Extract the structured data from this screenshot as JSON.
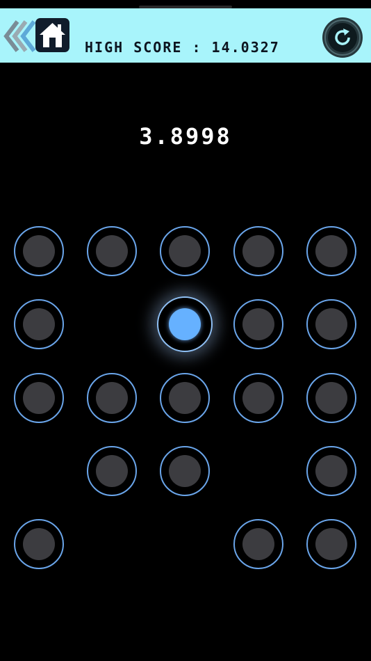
{
  "header": {
    "back_icon": "double-chevron-left-icon",
    "home_icon": "home-icon",
    "high_score_text": "HIGH SCORE : 14.0327",
    "restart_icon": "restart-icon"
  },
  "current_score": "3.8998",
  "colors": {
    "topbar": "#a8f4fb",
    "background": "#000000",
    "dot_ring": "#6aa5ea",
    "dot_core": "#3c3c40",
    "dot_active": "#66b1ff"
  },
  "grid": {
    "columns": 5,
    "rows": 5,
    "cells": [
      [
        1,
        1,
        1,
        1,
        1
      ],
      [
        1,
        0,
        2,
        1,
        1
      ],
      [
        1,
        1,
        1,
        1,
        1
      ],
      [
        0,
        1,
        1,
        0,
        1
      ],
      [
        1,
        0,
        0,
        1,
        1
      ]
    ],
    "legend": {
      "0": "empty",
      "1": "inactive dot",
      "2": "lit dot"
    }
  }
}
